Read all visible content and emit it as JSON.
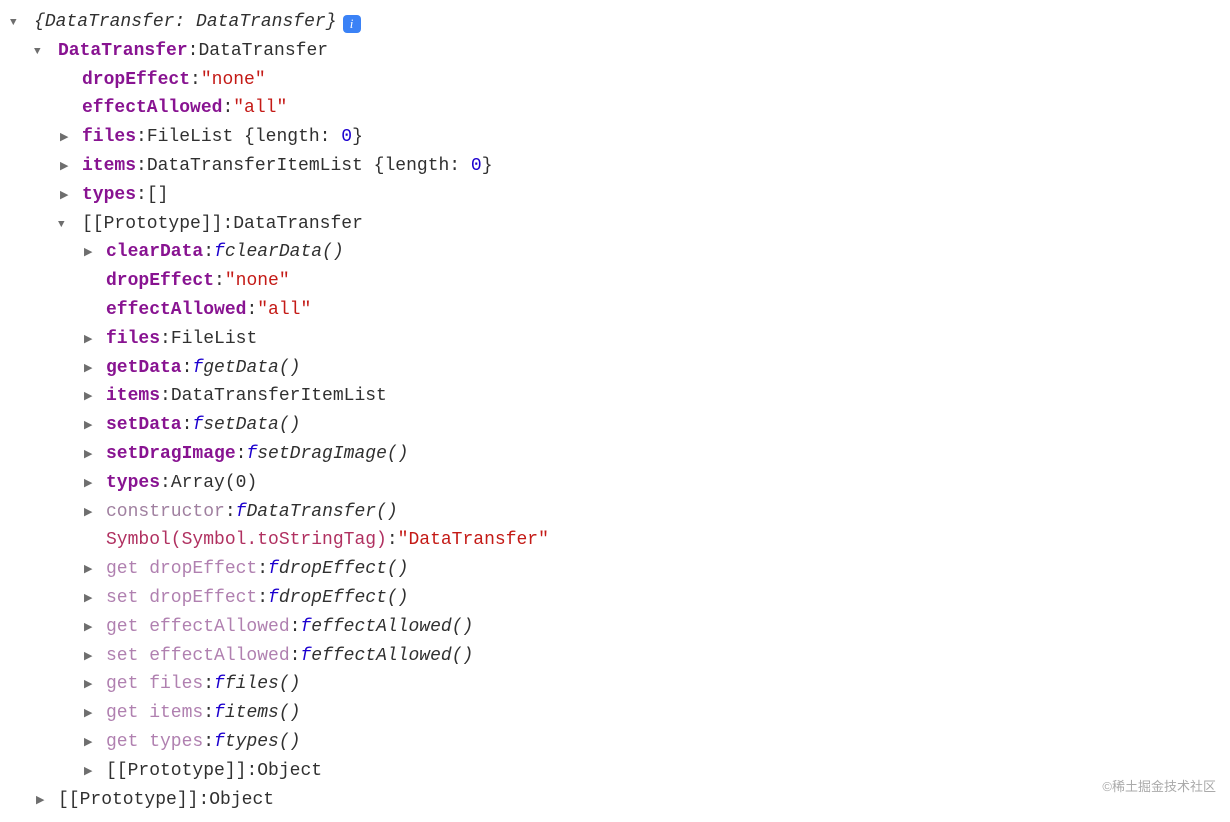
{
  "root": {
    "summary_open": "{",
    "summary_key": "DataTransfer:",
    "summary_val": " DataTransfer",
    "summary_close": "}",
    "info_badge": "i"
  },
  "dt": {
    "key": "DataTransfer",
    "val": "DataTransfer",
    "dropEffect_key": "dropEffect",
    "dropEffect_val": "\"none\"",
    "effectAllowed_key": "effectAllowed",
    "effectAllowed_val": "\"all\"",
    "files_key": "files",
    "files_val_cls": "FileList ",
    "files_val_brace": "{",
    "files_len_key": "length: ",
    "files_len_val": "0",
    "files_val_brace2": "}",
    "items_key": "items",
    "items_val_cls": "DataTransferItemList ",
    "items_val_brace": "{",
    "items_len_key": "length: ",
    "items_len_val": "0",
    "items_val_brace2": "}",
    "types_key": "types",
    "types_val": "[]",
    "proto_key": "[[Prototype]]",
    "proto_val": "DataTransfer"
  },
  "proto": {
    "clearData_key": "clearData",
    "clearData_fn": "clearData()",
    "dropEffect_key": "dropEffect",
    "dropEffect_val": "\"none\"",
    "effectAllowed_key": "effectAllowed",
    "effectAllowed_val": "\"all\"",
    "files_key": "files",
    "files_val": "FileList",
    "getData_key": "getData",
    "getData_fn": "getData()",
    "items_key": "items",
    "items_val": "DataTransferItemList",
    "setData_key": "setData",
    "setData_fn": "setData()",
    "setDragImage_key": "setDragImage",
    "setDragImage_fn": "setDragImage()",
    "types_key": "types",
    "types_val": "Array(0)",
    "constructor_key": "constructor",
    "constructor_fn": "DataTransfer()",
    "symbol_key": "Symbol(Symbol.toStringTag)",
    "symbol_val": "\"DataTransfer\"",
    "get_dropEffect_key": "get dropEffect",
    "get_dropEffect_fn": "dropEffect()",
    "set_dropEffect_key": "set dropEffect",
    "set_dropEffect_fn": "dropEffect()",
    "get_effectAllowed_key": "get effectAllowed",
    "get_effectAllowed_fn": "effectAllowed()",
    "set_effectAllowed_key": "set effectAllowed",
    "set_effectAllowed_fn": "effectAllowed()",
    "get_files_key": "get files",
    "get_files_fn": "files()",
    "get_items_key": "get items",
    "get_items_fn": "items()",
    "get_types_key": "get types",
    "get_types_fn": "types()",
    "proto_key": "[[Prototype]]",
    "proto_val": "Object"
  },
  "outer_proto": {
    "key": "[[Prototype]]",
    "val": "Object"
  },
  "ui": {
    "f": "f ",
    "colon": ": "
  },
  "watermark": "©稀土掘金技术社区"
}
